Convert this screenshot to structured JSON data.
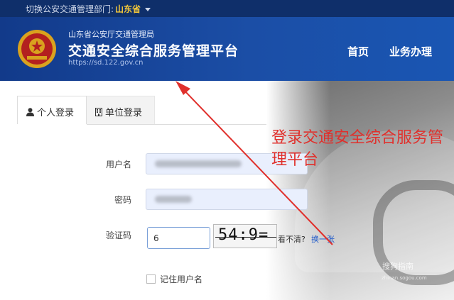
{
  "topbar": {
    "switch_label": "切换公安交通管理部门:",
    "province": "山东省"
  },
  "header": {
    "sub_title": "山东省公安厅交通管理局",
    "title": "交通安全综合服务管理平台",
    "url": "https://sd.122.gov.cn",
    "nav": [
      "首页",
      "业务办理"
    ]
  },
  "tabs": {
    "personal": "个人登录",
    "unit": "单位登录"
  },
  "form": {
    "username_label": "用户名",
    "password_label": "密码",
    "captcha_label": "验证码",
    "captcha_value": "6",
    "captcha_image_text": "54:9=",
    "cant_see": "看不清?",
    "change": "换一张",
    "remember_label": "记住用户名"
  },
  "annotation": "登录交通安全综合服务管理平台",
  "watermark": {
    "brand": "搜狗指南",
    "site": "zhinan.sogou.com"
  },
  "colors": {
    "header_blue": "#1b4ea6",
    "topbar": "#0f2f6a",
    "province_gold": "#f4c83a",
    "annotation_red": "#e0302c",
    "link_blue": "#1a56c9"
  }
}
